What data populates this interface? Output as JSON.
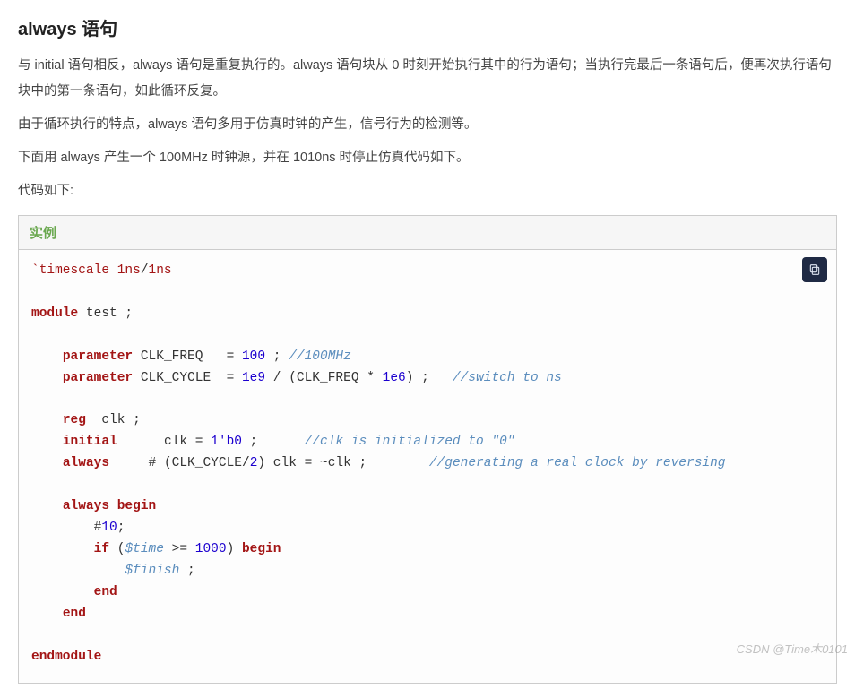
{
  "heading": "always 语句",
  "paragraphs": [
    "与 initial 语句相反，always 语句是重复执行的。always 语句块从 0 时刻开始执行其中的行为语句；当执行完最后一条语句后，便再次执行语句块中的第一条语句，如此循环反复。",
    "由于循环执行的特点，always 语句多用于仿真时钟的产生，信号行为的检测等。",
    "下面用 always 产生一个 100MHz 时钟源，并在 1010ns 时停止仿真代码如下。",
    "代码如下:"
  ],
  "example": {
    "title": "实例",
    "copy_label": "copy"
  },
  "code": {
    "timescale_tick": "`timescale",
    "timescale_val": "1ns",
    "timescale_sep": "/",
    "timescale_val2": "1ns",
    "kw_module": "module",
    "mod_name": "test",
    "kw_parameter": "parameter",
    "p1_name": "CLK_FREQ",
    "p1_eq": "=",
    "p1_val": "100",
    "p1_comment": "//100MHz",
    "p2_name": "CLK_CYCLE",
    "p2_eq": "=",
    "p2_exp_a": "1e9",
    "p2_div": "/",
    "p2_lpar": "(",
    "p2_id": "CLK_FREQ",
    "p2_mul": "*",
    "p2_exp_b": "1e6",
    "p2_rpar": ")",
    "p2_comment": "//switch to ns",
    "kw_reg": "reg",
    "reg_name": "clk",
    "kw_initial": "initial",
    "init_id": "clk",
    "init_eq": "=",
    "init_val": "1'b0",
    "init_comment": "//clk is initialized to \"0\"",
    "kw_always": "always",
    "aw_hash": "#",
    "aw_lpar": "(",
    "aw_id": "CLK_CYCLE",
    "aw_div": "/",
    "aw_two": "2",
    "aw_rpar": ")",
    "aw_clk": "clk",
    "aw_eq": "=",
    "aw_not": "~",
    "aw_clk2": "clk",
    "aw_comment": "//generating a real clock by reversing",
    "kw_always2": "always",
    "kw_begin": "begin",
    "d_hash": "#",
    "d_ten": "10",
    "d_semi": ";",
    "kw_if": "if",
    "if_lpar": "(",
    "sys_time": "$time",
    "if_ge": ">=",
    "if_val": "1000",
    "if_rpar": ")",
    "kw_begin2": "begin",
    "sys_finish": "$finish",
    "fin_semi": ";",
    "kw_end": "end",
    "kw_end2": "end",
    "kw_endmodule": "endmodule"
  },
  "watermark": "CSDN @Time木0101"
}
